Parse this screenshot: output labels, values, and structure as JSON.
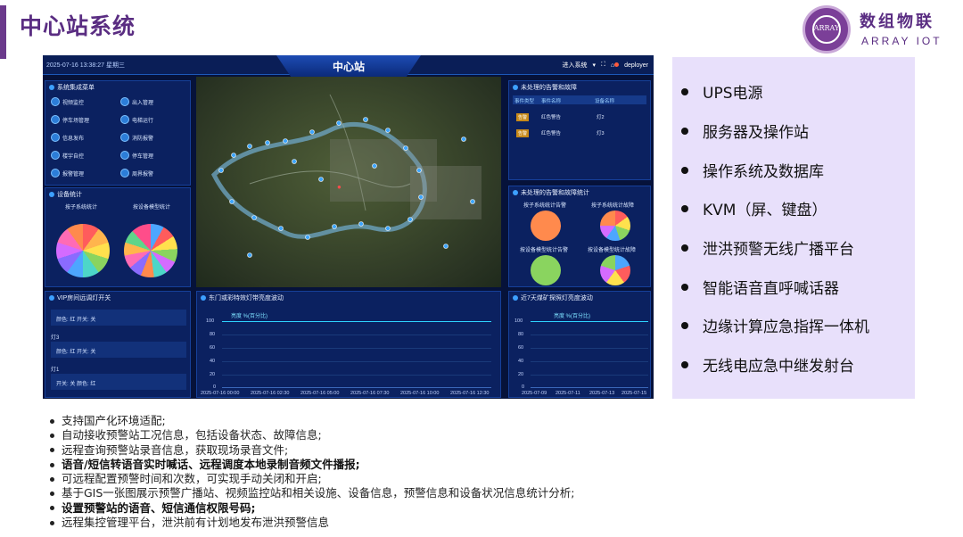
{
  "slide": {
    "title": "中心站系统",
    "logo": {
      "cn": "数组物联",
      "en": "ARRAY IOT",
      "badge_text": "ARRAY"
    }
  },
  "dashboard": {
    "datetime": "2025-07-16 13:38:27 星期三",
    "title": "中心站",
    "enter_system": "进入系统",
    "user": "deployer",
    "menu_panel": {
      "title": "系统集成菜单",
      "items": [
        "视频监控",
        "出入管理",
        "停车场管理",
        "电梯运行",
        "信息发布",
        "消防报警",
        "楼宇自控",
        "停车管理",
        "报警管理",
        "周界报警"
      ]
    },
    "device_stats": {
      "title": "设备统计",
      "left_label": "按子系统统计",
      "right_label": "按设备模型统计"
    },
    "vip": {
      "title": "VIP房间远调灯开关",
      "rows": [
        {
          "text": "颜色: 红  开关: 关"
        },
        {
          "lamp": "灯3",
          "text": "颜色: 红  开关: 关"
        },
        {
          "lamp": "灯1",
          "text": "开关: 关  颜色: 红"
        }
      ]
    },
    "alarms": {
      "title": "未处理的告警和故障",
      "headers": [
        "事件类型",
        "事件名称",
        "设备名称"
      ],
      "rows": [
        {
          "type": "告警",
          "name": "红色警告",
          "device": "灯2"
        },
        {
          "type": "告警",
          "name": "红色警告",
          "device": "灯3"
        }
      ]
    },
    "alarm_stats": {
      "title": "未处理的告警和故障统计",
      "labels": [
        "按子系统统计告警",
        "按子系统统计故障",
        "按设备模型统计告警",
        "按设备模型统计故障"
      ]
    },
    "brightness_chart": {
      "title": "东门或彩特效灯带亮度波动",
      "legend": "亮度 %(百分比)",
      "y_ticks": [
        "100",
        "80",
        "60",
        "40",
        "20",
        "0"
      ],
      "x_ticks": [
        "2025-07-16 00:00",
        "2025-07-16 02:30",
        "2025-07-16 05:00",
        "2025-07-16 07:30",
        "2025-07-16 10:00",
        "2025-07-16 12:30"
      ]
    },
    "week_chart": {
      "title": "近7天煤矿探照灯亮度波动",
      "legend": "亮度 %(百分比)",
      "y_ticks": [
        "100",
        "80",
        "60",
        "40",
        "20",
        "0"
      ],
      "x_ticks": [
        "2025-07-09",
        "2025-07-11",
        "2025-07-13",
        "2025-07-15"
      ]
    }
  },
  "side_list": [
    "UPS电源",
    "服务器及操作站",
    "操作系统及数据库",
    "KVM（屏、键盘）",
    "泄洪预警无线广播平台",
    "智能语音直呼喊话器",
    "边缘计算应急指挥一体机",
    "无线电应急中继发射台"
  ],
  "features": [
    {
      "text": "支持国产化环境适配;",
      "bold": false
    },
    {
      "text": "自动接收预警站工况信息，包括设备状态、故障信息;",
      "bold": false
    },
    {
      "text": "远程查询预警站录音信息，获取现场录音文件;",
      "bold": false
    },
    {
      "text": "语音/短信转语音实时喊话、远程调度本地录制音频文件播报;",
      "bold": true
    },
    {
      "text": "可远程配置预警时间和次数，可实现手动关闭和开启;",
      "bold": false
    },
    {
      "text": "基于GIS一张图展示预警广播站、视频监控站和相关设施、设备信息，预警信息和设备状况信息统计分析;",
      "bold": false
    },
    {
      "text": "设置预警站的语音、短信通信权限号码;",
      "bold": true
    },
    {
      "text": "远程集控管理平台，泄洪前有计划地发布泄洪预警信息",
      "bold": false
    }
  ]
}
